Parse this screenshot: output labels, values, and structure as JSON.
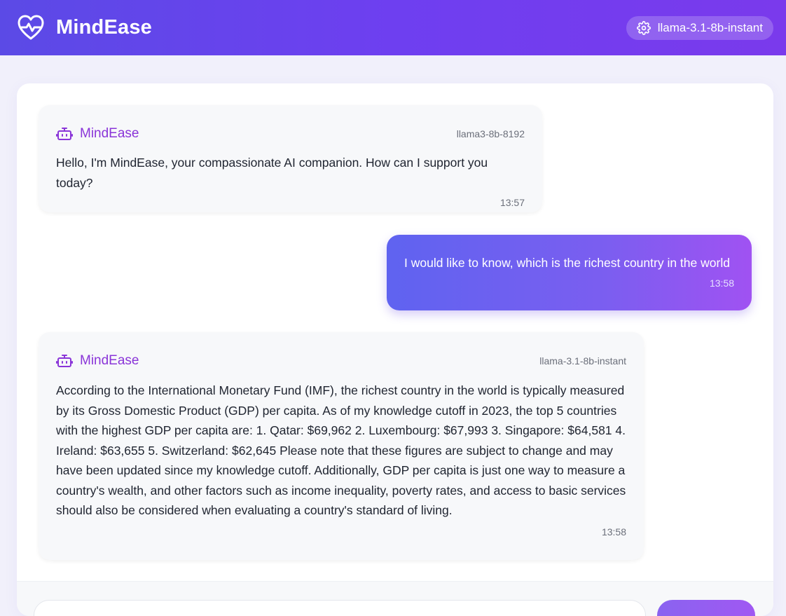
{
  "app": {
    "title": "MindEase",
    "model_selector": {
      "label": "llama-3.1-8b-instant",
      "icon": "gear-icon"
    },
    "colors": {
      "header_start": "#5b4ae6",
      "header_end": "#7a3aec",
      "accent": "#8a35d8"
    }
  },
  "messages": [
    {
      "role": "assistant",
      "sender": "MindEase",
      "model": "llama3-8b-8192",
      "text": "Hello, I'm MindEase, your compassionate AI companion. How can I support you today?",
      "time": "13:57",
      "icon": "robot-icon"
    },
    {
      "role": "user",
      "text": "I would like to know, which is the richest country in the world",
      "time": "13:58"
    },
    {
      "role": "assistant",
      "sender": "MindEase",
      "model": "llama-3.1-8b-instant",
      "text": "According to the International Monetary Fund (IMF), the richest country in the world is typically measured by its Gross Domestic Product (GDP) per capita. As of my knowledge cutoff in 2023, the top 5 countries with the highest GDP per capita are: 1. Qatar: $69,962 2. Luxembourg: $67,993 3. Singapore: $64,581 4. Ireland: $63,655 5. Switzerland: $62,645 Please note that these figures are subject to change and may have been updated since my knowledge cutoff. Additionally, GDP per capita is just one way to measure a country's wealth, and other factors such as income inequality, poverty rates, and access to basic services should also be considered when evaluating a country's standard of living.",
      "time": "13:58",
      "icon": "robot-icon"
    }
  ]
}
